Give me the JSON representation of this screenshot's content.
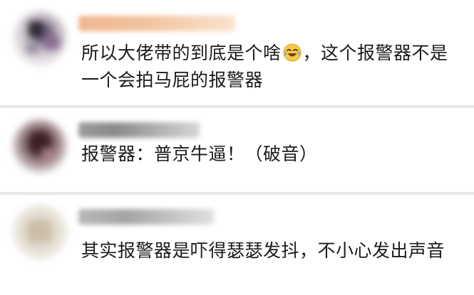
{
  "comments": [
    {
      "text_before_emoji": "所以大佬带的到底是个啥",
      "emoji": "laughing-tears-emoji",
      "text_after_emoji": "，这个报警器不是一个会拍马屁的报警器"
    },
    {
      "text": "报警器：普京牛逼！（破音）"
    },
    {
      "text": "其实报警器是吓得瑟瑟发抖，不小心发出声音"
    }
  ]
}
